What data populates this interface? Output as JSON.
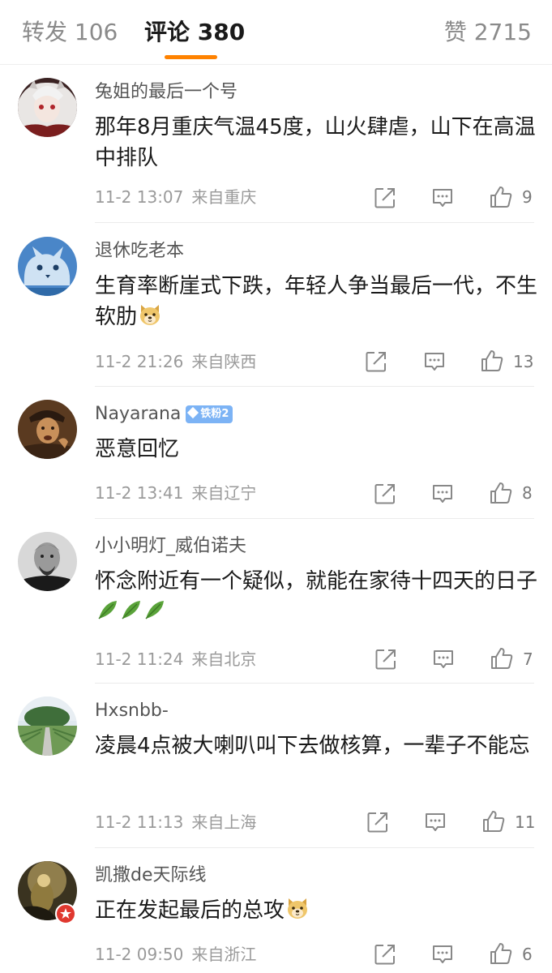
{
  "tabs": {
    "repost": "转发 106",
    "comments": "评论 380",
    "likes": "赞 2715"
  },
  "colors": {
    "active_tab_indicator": "#ff8200",
    "fan_badge": "#7cb3f5",
    "verified_badge": "#e0382f"
  },
  "comments": [
    {
      "username": "兔姐的最后一个号",
      "text": "那年8月重庆气温45度，山火肆虐，山下在高温中排队",
      "time": "11-2 13:07",
      "location": "来自重庆",
      "likes": "9",
      "avatar_icon": "anime-girl-avatar"
    },
    {
      "username": "退休吃老本",
      "text": "生育率断崖式下跌，年轻人争当最后一代，不生软肋",
      "emoji": "doge-emoji",
      "time": "11-2 21:26",
      "location": "来自陕西",
      "likes": "13",
      "avatar_icon": "blue-cat-avatar"
    },
    {
      "username": "Nayarana",
      "fan_badge": "铁粉2",
      "text": "恶意回忆",
      "time": "11-2 13:41",
      "location": "来自辽宁",
      "likes": "8",
      "avatar_icon": "painting-portrait-avatar"
    },
    {
      "username": "小小明灯_威伯诺夫",
      "text": "怀念附近有一个疑似，就能在家待十四天的日子",
      "emoji": "leaf-emoji-x3",
      "time": "11-2 11:24",
      "location": "来自北京",
      "likes": "7",
      "avatar_icon": "bw-portrait-avatar"
    },
    {
      "username": "Hxsnbb-",
      "text": "凌晨4点被大喇叭叫下去做核算，一辈子不能忘",
      "time": "11-2 11:13",
      "location": "来自上海",
      "likes": "11",
      "avatar_icon": "tree-road-avatar"
    },
    {
      "username": "凯撒de天际线",
      "text": "正在发起最后的总攻",
      "emoji": "doge-emoji",
      "time": "11-2 09:50",
      "location": "来自浙江",
      "likes": "6",
      "avatar_icon": "figure-avatar",
      "verified_icon": "verified-star-icon"
    }
  ],
  "action_icons": [
    "share-icon",
    "reply-icon",
    "like-icon"
  ]
}
